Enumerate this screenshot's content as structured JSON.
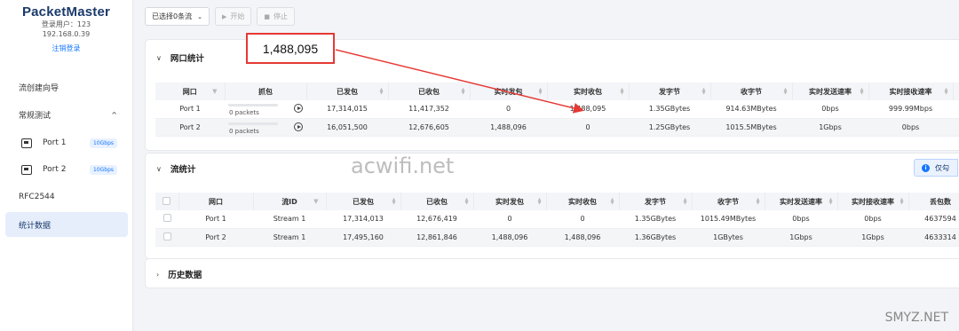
{
  "sidebar": {
    "app_title": "PacketMaster",
    "login_user": "登录用户：123",
    "ip": "192.168.0.39",
    "logout": "注销登录",
    "items": [
      {
        "label": "流创建向导"
      },
      {
        "label": "常规测试",
        "chevron": "^"
      },
      {
        "label": "Port 1",
        "badge": "10Gbps"
      },
      {
        "label": "Port 2",
        "badge": "10Gbps"
      },
      {
        "label": "RFC2544"
      },
      {
        "label": "统计数据",
        "active": true
      }
    ]
  },
  "toolbar": {
    "select_label": "已选择0条流",
    "start_label": "开始",
    "stop_label": "停止"
  },
  "port_stats": {
    "title": "网口统计",
    "headers": [
      "网口",
      "抓包",
      "已发包",
      "已收包",
      "实时发包",
      "实时收包",
      "发字节",
      "收字节",
      "实时发送速率",
      "实时接收速率"
    ],
    "rows": [
      {
        "port": "Port 1",
        "capture": "0 packets",
        "sent": "17,314,015",
        "recv": "11,417,352",
        "rt_sent": "0",
        "rt_recv": "1,488,095",
        "tx_bytes": "1.35GBytes",
        "rx_bytes": "914.63MBytes",
        "tx_rate": "0bps",
        "rx_rate": "999.99Mbps"
      },
      {
        "port": "Port 2",
        "capture": "0 packets",
        "sent": "16,051,500",
        "recv": "12,676,605",
        "rt_sent": "1,488,096",
        "rt_recv": "0",
        "tx_bytes": "1.25GBytes",
        "rx_bytes": "1015.5MBytes",
        "tx_rate": "1Gbps",
        "rx_rate": "0bps"
      }
    ]
  },
  "flow_stats": {
    "title": "流统计",
    "info_label": "仅勾",
    "headers": [
      "网口",
      "流ID",
      "已发包",
      "已收包",
      "实时发包",
      "实时收包",
      "发字节",
      "收字节",
      "实时发送速率",
      "实时接收速率",
      "丢包数"
    ],
    "rows": [
      {
        "port": "Port 1",
        "stream": "Stream 1",
        "sent": "17,314,013",
        "recv": "12,676,419",
        "rt_sent": "0",
        "rt_recv": "0",
        "tx_bytes": "1.35GBytes",
        "rx_bytes": "1015.49MBytes",
        "tx_rate": "0bps",
        "rx_rate": "0bps",
        "lost": "4637594"
      },
      {
        "port": "Port 2",
        "stream": "Stream 1",
        "sent": "17,495,160",
        "recv": "12,861,846",
        "rt_sent": "1,488,096",
        "rt_recv": "1,488,096",
        "tx_bytes": "1.36GBytes",
        "rx_bytes": "1GBytes",
        "tx_rate": "1Gbps",
        "rx_rate": "1Gbps",
        "lost": "4633314"
      }
    ]
  },
  "history": {
    "title": "历史数据"
  },
  "annotation": {
    "callout_value": "1,488,095",
    "arrow_color": "#e53935"
  },
  "watermarks": {
    "center": "acwifi.net",
    "corner": "SMYZ.NET"
  },
  "colors": {
    "accent": "#1677ff",
    "brand": "#1a3a6b"
  }
}
